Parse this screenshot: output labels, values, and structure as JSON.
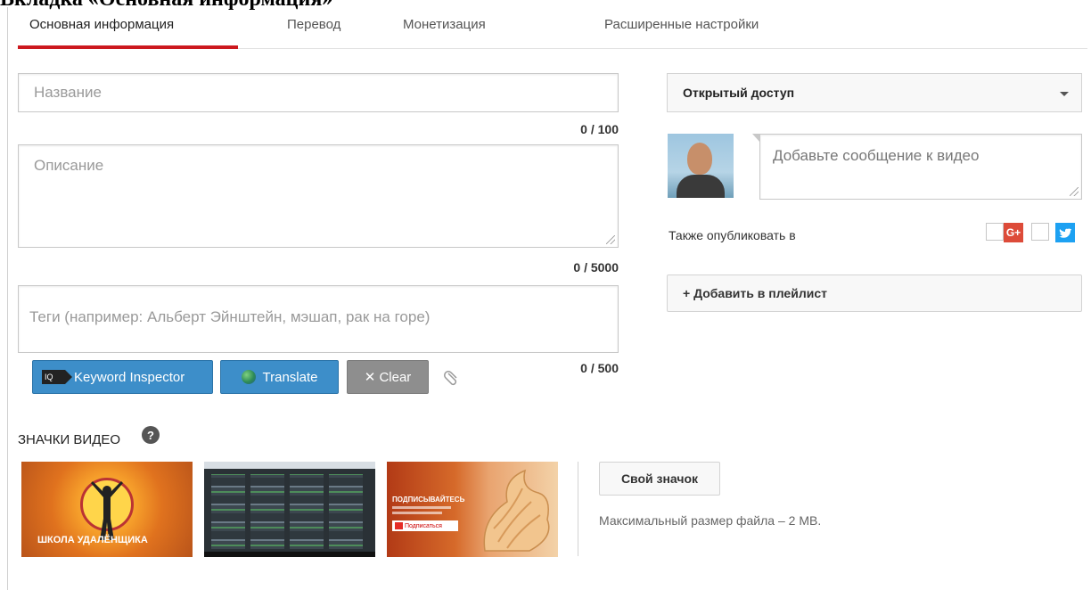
{
  "page_heading": "Вкладка «Основная информация»",
  "tabs": [
    {
      "label": "Основная информация",
      "active": true
    },
    {
      "label": "Перевод",
      "active": false
    },
    {
      "label": "Монетизация",
      "active": false
    },
    {
      "label": "Расширенные настройки",
      "active": false
    }
  ],
  "title_field": {
    "placeholder": "Название",
    "counter": "0 / 100"
  },
  "description_field": {
    "placeholder": "Описание",
    "counter": "0 / 5000"
  },
  "tags_field": {
    "placeholder": "Теги (например: Альберт Эйнштейн, мэшап, рак на горе)",
    "counter": "0 / 500"
  },
  "tag_tools": {
    "keyword_inspector": "Keyword Inspector",
    "keyword_inspector_logo": "IQ",
    "translate": "Translate",
    "clear": "✕ Clear"
  },
  "thumbnails": {
    "title": "ЗНАЧКИ ВИДЕО",
    "help_icon": "?",
    "thumb1_text": "ШКОЛА УДАЛЁНЩИКА",
    "thumb3_title": "ПОДПИСЫВАЙТЕСЬ",
    "thumb3_button": "Подписаться",
    "custom_button": "Свой значок",
    "max_size_note": "Максимальный размер файла – 2 MB."
  },
  "privacy": {
    "selected": "Открытый доступ"
  },
  "message_field": {
    "placeholder": "Добавьте сообщение к видео"
  },
  "share": {
    "label": "Также опубликовать в",
    "gplus": "G+"
  },
  "playlist_button": "+ Добавить в плейлист",
  "colors": {
    "tab_active": "#cc181e",
    "button_blue": "#3d8ec9",
    "button_gray": "#8e8e8e",
    "gplus": "#dd4b39",
    "twitter": "#1da1f2"
  }
}
